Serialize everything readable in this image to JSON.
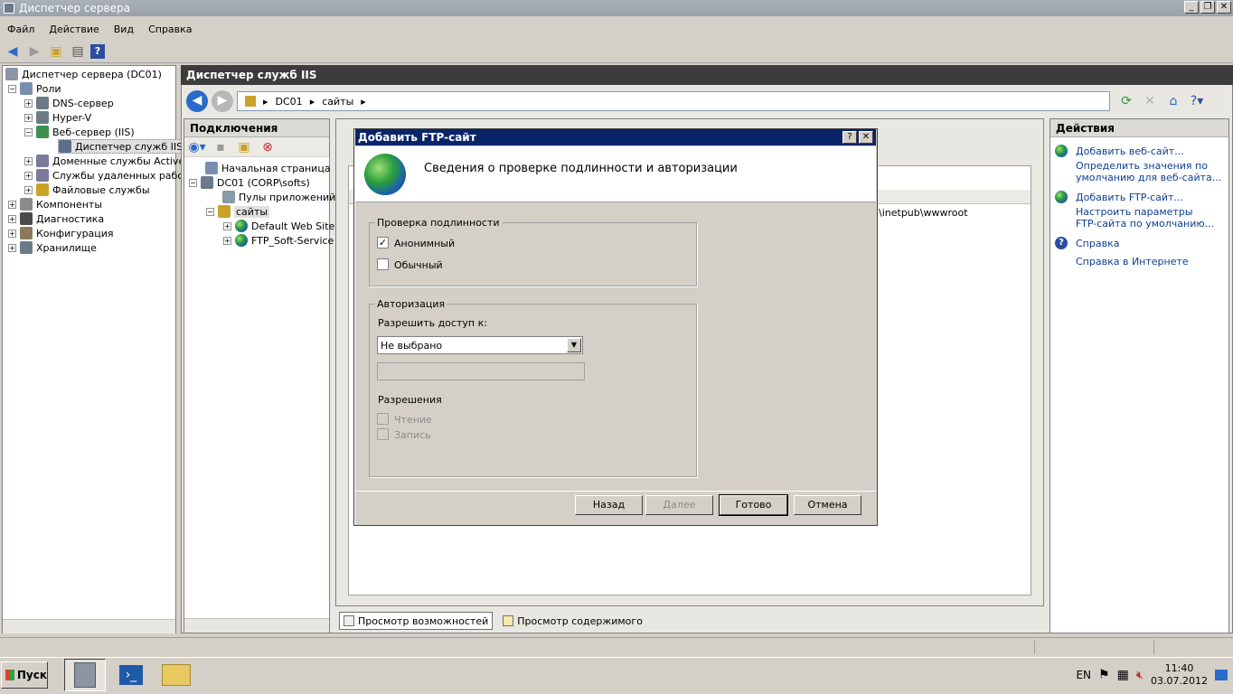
{
  "window": {
    "title": "Диспетчер сервера"
  },
  "menu": [
    "Файл",
    "Действие",
    "Вид",
    "Справка"
  ],
  "tree": {
    "root": "Диспетчер сервера (DC01)",
    "roles": "Роли",
    "dns": "DNS-сервер",
    "hyperv": "Hyper-V",
    "web": "Веб-сервер (IIS)",
    "iis": "Диспетчер служб IIS",
    "ad": "Доменные службы Active",
    "rds": "Службы удаленных рабоч",
    "file": "Файловые службы",
    "components": "Компоненты",
    "diagnostics": "Диагностика",
    "configuration": "Конфигурация",
    "storage": "Хранилище"
  },
  "iis": {
    "title": "Диспетчер служб IIS",
    "address": [
      "DC01",
      "сайты"
    ],
    "connections_title": "Подключения",
    "conn_tree": {
      "start": "Начальная страница",
      "server": "DC01 (CORP\\softs)",
      "pools": "Пулы приложений",
      "sites": "сайты",
      "default_site": "Default Web Site",
      "ftp_site": "FTP_Soft-Service"
    },
    "path_fragment": "\\inetpub\\wwwroot",
    "view_tabs": [
      "Просмотр возможностей",
      "Просмотр содержимого"
    ]
  },
  "actions": {
    "title": "Действия",
    "items": [
      {
        "label": "Добавить веб-сайт...",
        "icon": "add-site-icon"
      },
      {
        "label": "Определить значения по умолчанию для веб-сайта...",
        "line1": "Определить значения по",
        "line2": "умолчанию для веб-сайта...",
        "icon": ""
      },
      {
        "label": "Добавить FTP-сайт...",
        "icon": "add-ftp-icon"
      },
      {
        "label": "Настроить параметры FTP-сайта по умолчанию...",
        "line1": "Настроить параметры",
        "line2": "FTP-сайта по умолчанию...",
        "icon": ""
      },
      {
        "label": "Справка",
        "icon": "help-icon"
      },
      {
        "label": "Справка в Интернете",
        "icon": ""
      }
    ]
  },
  "dialog": {
    "title": "Добавить FTP-сайт",
    "header": "Сведения о проверке подлинности и авторизации",
    "auth_group": "Проверка подлинности",
    "anonymous": {
      "label": "Анонимный",
      "checked": true
    },
    "basic": {
      "label": "Обычный",
      "checked": false
    },
    "authz_group": "Авторизация",
    "allow_label": "Разрешить доступ к:",
    "allow_value": "Не выбрано",
    "permissions_label": "Разрешения",
    "read": {
      "label": "Чтение",
      "checked": false,
      "enabled": false
    },
    "write": {
      "label": "Запись",
      "checked": false,
      "enabled": false
    },
    "buttons": {
      "back": "Назад",
      "next": "Далее",
      "finish": "Готово",
      "cancel": "Отмена"
    }
  },
  "taskbar": {
    "start": "Пуск",
    "lang": "EN",
    "time": "11:40",
    "date": "03.07.2012"
  },
  "colors": {
    "dialog_title": "#0a246a",
    "link": "#0b3e93",
    "iis_title": "#3c3c3c"
  }
}
